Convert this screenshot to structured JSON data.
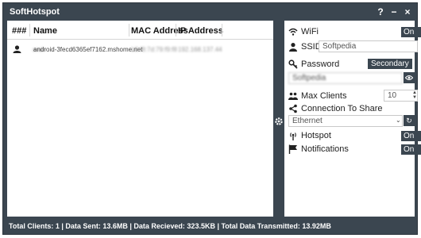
{
  "window": {
    "title": "SoftHotspot",
    "help_label": "?",
    "minimize_label": "−",
    "close_label": "×"
  },
  "clients_table": {
    "columns": [
      "###",
      "Name",
      "MAC Address",
      "IP Address"
    ],
    "rows": [
      {
        "icon": "user-icon",
        "name": "android-3fecd6365ef7162.mshome.net",
        "mac": "b8:f8:7d:79:f9:f8",
        "ip": "192.168.137.44"
      }
    ]
  },
  "settings": {
    "wifi": {
      "label": "WiFi",
      "value": "On",
      "icon": "wifi-icon"
    },
    "ssid": {
      "label": "SSID",
      "value": "Softpedia",
      "icon": "user-icon"
    },
    "password": {
      "label": "Password",
      "mode": "Secondary",
      "value": "Softpedia",
      "icon": "key-icon",
      "reveal_icon": "eye-icon"
    },
    "max_clients": {
      "label": "Max Clients",
      "value": "10",
      "icon": "group-icon"
    },
    "connection_to_share": {
      "label": "Connection To Share",
      "value": "Ethernet",
      "icon": "share-icon",
      "refresh_icon": "refresh-icon"
    },
    "hotspot": {
      "label": "Hotspot",
      "value": "On",
      "icon": "antenna-icon"
    },
    "notifications": {
      "label": "Notifications",
      "value": "On",
      "icon": "flag-icon"
    }
  },
  "status_bar": {
    "text": "Total Clients: 1 | Data Sent: 13.6MB | Data Recieved: 323.5KB | Total Data Transmitted: 13.92MB"
  },
  "colors": {
    "frame": "#3b4650",
    "panel": "#ffffff",
    "text": "#222222"
  }
}
